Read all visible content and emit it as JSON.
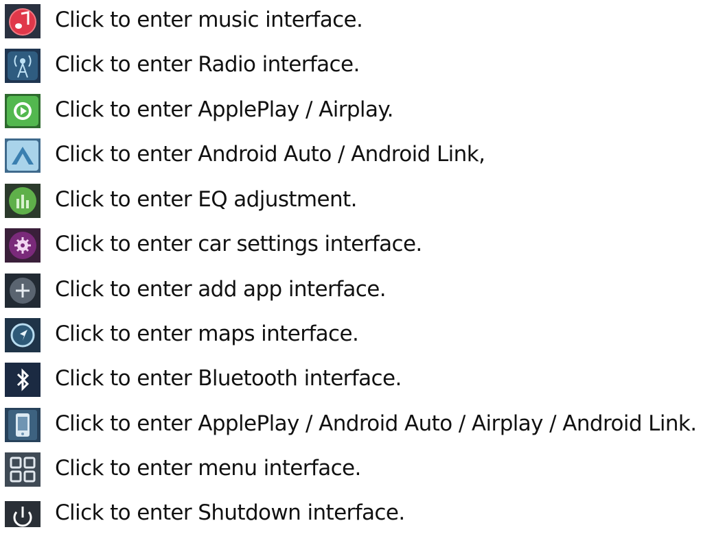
{
  "items": [
    {
      "icon": "music-icon",
      "label": "Click to enter music interface."
    },
    {
      "icon": "radio-icon",
      "label": "Click to enter Radio interface."
    },
    {
      "icon": "appleplay-icon",
      "label": "Click to enter ApplePlay / Airplay."
    },
    {
      "icon": "android-auto-icon",
      "label": "Click to enter Android Auto / Android Link,"
    },
    {
      "icon": "eq-icon",
      "label": "Click to enter EQ adjustment."
    },
    {
      "icon": "car-settings-icon",
      "label": "Click to enter car settings interface."
    },
    {
      "icon": "add-app-icon",
      "label": "Click to enter add app interface."
    },
    {
      "icon": "maps-icon",
      "label": "Click to enter maps interface."
    },
    {
      "icon": "bluetooth-icon",
      "label": "Click to enter Bluetooth interface."
    },
    {
      "icon": "phone-link-icon",
      "label": "Click to enter ApplePlay / Android Auto / Airplay / Android Link."
    },
    {
      "icon": "menu-grid-icon",
      "label": "Click to enter menu interface."
    },
    {
      "icon": "power-icon",
      "label": "Click to enter Shutdown interface."
    }
  ]
}
